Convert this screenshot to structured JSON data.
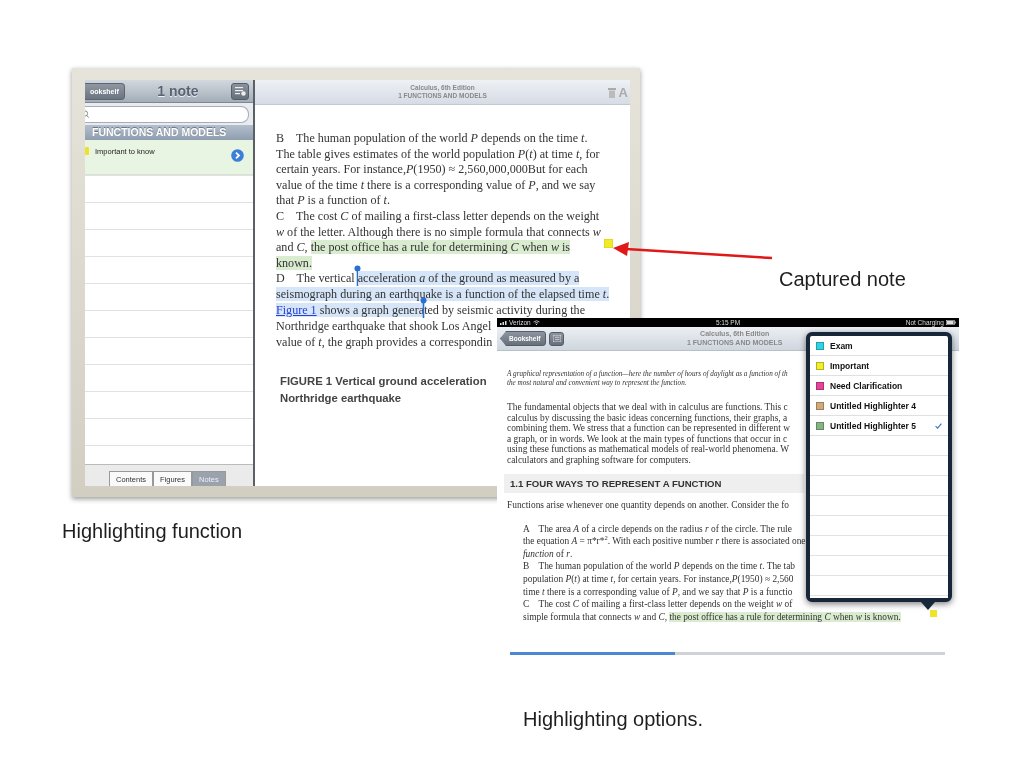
{
  "left_screenshot": {
    "sidebar": {
      "back_button": "ookshelf",
      "title": "1 note",
      "section_header": "FUNCTIONS AND MODELS",
      "notes": [
        {
          "text": "Important to know"
        }
      ],
      "tabs": [
        {
          "label": "Contents",
          "selected": false
        },
        {
          "label": "Figures",
          "selected": false
        },
        {
          "label": "Notes",
          "selected": true
        }
      ]
    },
    "reader": {
      "title": "Calculus, 6th Edition",
      "subtitle": "1 FUNCTIONS AND MODELS",
      "font_button": "A",
      "paragraphs": [
        {
          "lines": [
            [
              "B    The human population of the world *P* depends on the time *t*."
            ],
            [
              "The table gives estimates of the world population *P*(*t*) at time *t*, for"
            ],
            [
              "certain years. For instance,*P*(1950) ≈ 2,560,000,000But for each"
            ],
            [
              "value of the time *t* there is a corresponding value of *P*, and we say"
            ],
            [
              "that *P* is a function of *t*."
            ]
          ]
        },
        {
          "lines": [
            [
              "C    The cost *C* of mailing a first-class letter depends on the weight"
            ],
            [
              "*w* of the letter. Although there is no simple formula that connects *w*"
            ],
            [
              "and *C*, ",
              {
                "text": "the post office has a rule for determining *C* when *w* is",
                "kind": "highlight"
              }
            ],
            [
              {
                "text": "known.",
                "kind": "highlight"
              }
            ]
          ]
        },
        {
          "lines": [
            [
              "D    The vertical ",
              {
                "text": "acceleration *a* of the ground as measured by a",
                "kind": "selection"
              }
            ],
            [
              {
                "text": "seismograph during an earthquake is a function of the elapsed time *t*.",
                "kind": "selection"
              }
            ],
            [
              {
                "text": "Figure 1",
                "kind": "link"
              },
              {
                "text": " shows a graph genera",
                "kind": "selection"
              },
              "ted by seismic activity during the"
            ],
            [
              "Northridge earthquake that shook Los Angel"
            ],
            [
              "value of *t*, the graph provides a correspondin"
            ]
          ]
        }
      ],
      "figure_caption": [
        "FIGURE 1 Vertical ground acceleration",
        "Northridge earthquake"
      ]
    }
  },
  "callout": {
    "label": "Captured note"
  },
  "left_caption": "Highlighting function",
  "right_screenshot": {
    "status_bar": {
      "carrier": "Verizon",
      "time": "5:15 PM",
      "battery": "Not Charging"
    },
    "nav": {
      "back_button": "Bookshelf",
      "title": "Calculus, 6th Edition",
      "subtitle": "1 FUNCTIONS AND MODELS"
    },
    "figure_note": [
      "A graphical representation of a function—here the number of hours of daylight as a function of th",
      "the most natural and convenient way to represent the function."
    ],
    "intro": {
      "lines": [
        [
          "The fundamental objects that we deal with in calculus are functions. This c"
        ],
        [
          "calculus by discussing the basic ideas concerning functions, their graphs, a"
        ],
        [
          "combining them. We stress that a function can be represented in different w"
        ],
        [
          "a graph, or in words. We look at the main types of functions that occur in c"
        ],
        [
          "using these functions as mathematical models of real-world phenomena. W"
        ],
        [
          "calculators and graphing software for computers."
        ]
      ]
    },
    "heading": "1.1 FOUR WAYS TO REPRESENT A FUNCTION",
    "lead": "Functions arise whenever one quantity depends on another. Consider the fo",
    "items": [
      {
        "lines": [
          [
            "A    The area *A* of a circle depends on the radius *r* of the circle. The rule"
          ],
          [
            "the equation *A* = π*r*$^{2}$. With each positive number *r* there is associated one"
          ],
          [
            "*function* of *r*."
          ]
        ]
      },
      {
        "lines": [
          [
            "B    The human population of the world *P* depends on the time *t*. The tab"
          ],
          [
            "population *P*(*t*) at time *t*, for certain years. For instance,*P*(1950) ≈ 2,560"
          ],
          [
            "time *t* there is a corresponding value of *P*, and we say that *P* is a functio"
          ]
        ]
      },
      {
        "lines": [
          [
            "C    The cost *C* of mailing a first-class letter depends on the weight *w* of"
          ],
          [
            "simple formula that connects *w* and *C*, ",
            {
              "text": "the post office has a rule for determining *C* when *w* is known.",
              "kind": "highlight"
            }
          ]
        ]
      }
    ],
    "highlighters": [
      {
        "name": "Exam",
        "color": "#2fd3e3",
        "selected": false
      },
      {
        "name": "Important",
        "color": "#f2ee2a",
        "selected": false
      },
      {
        "name": "Need Clarification",
        "color": "#e6449a",
        "selected": false
      },
      {
        "name": "Untitled Highlighter 4",
        "color": "#d2aa78",
        "selected": false
      },
      {
        "name": "Untitled Highlighter 5",
        "color": "#86b486",
        "selected": true
      }
    ],
    "page_slider": {
      "level": 0.38
    }
  },
  "right_caption": "Highlighting options."
}
